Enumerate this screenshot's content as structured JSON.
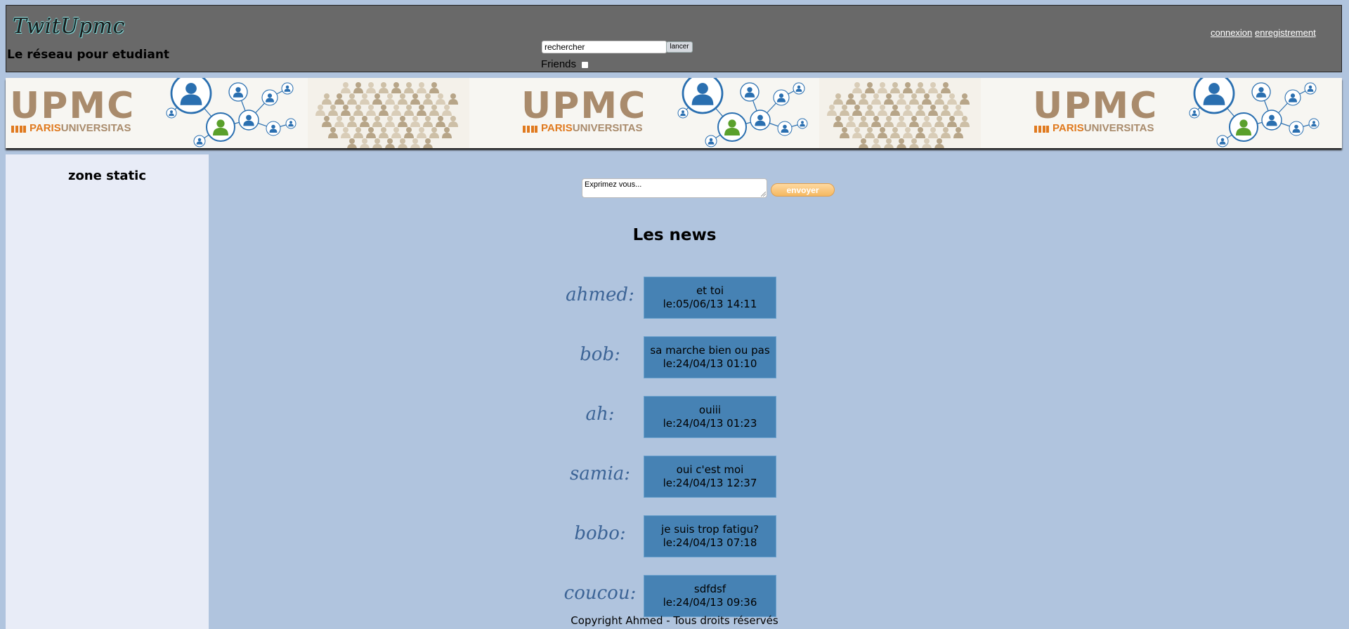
{
  "header": {
    "logo": "TwitUpmc",
    "tagline": "Le réseau pour etudiant",
    "search": {
      "value": "rechercher",
      "button_label": "lancer",
      "friends_label": "Friends"
    },
    "auth": {
      "login_label": "connexion",
      "register_label": "enregistrement"
    }
  },
  "banner": {
    "logo_text": "UPMC",
    "logo_subtitle_prefix": "PARIS",
    "logo_subtitle_suffix": "UNIVERSITAS",
    "colors": {
      "brand": "#a98b6c",
      "mark": "#e07a1f",
      "person_blue": "#2a6fb0",
      "person_green": "#5aa02c"
    }
  },
  "sidebar": {
    "title": "zone static"
  },
  "compose": {
    "placeholder": "Exprimez vous...",
    "send_label": "envoyer"
  },
  "news": {
    "title": "Les news",
    "items": [
      {
        "author": "ahmed:",
        "message": "et toi",
        "date": "le:05/06/13 14:11"
      },
      {
        "author": "bob:",
        "message": "sa marche bien ou pas",
        "date": "le:24/04/13 01:10"
      },
      {
        "author": "ah:",
        "message": "ouiii",
        "date": "le:24/04/13 01:23"
      },
      {
        "author": "samia:",
        "message": "oui c'est moi",
        "date": "le:24/04/13 12:37"
      },
      {
        "author": "bobo:",
        "message": "je suis trop fatigu?",
        "date": "le:24/04/13 07:18"
      },
      {
        "author": "coucou:",
        "message": "sdfdsf",
        "date": "le:24/04/13 09:36"
      }
    ]
  },
  "footer": {
    "copyright": "Copyright Ahmed - Tous droits réservés"
  },
  "colors": {
    "background": "#b0c4de",
    "header": "#696969",
    "sidebar": "#e8ecf7",
    "card": "#4682b4",
    "author": "#3c6496",
    "send_button": "#f5b860"
  }
}
